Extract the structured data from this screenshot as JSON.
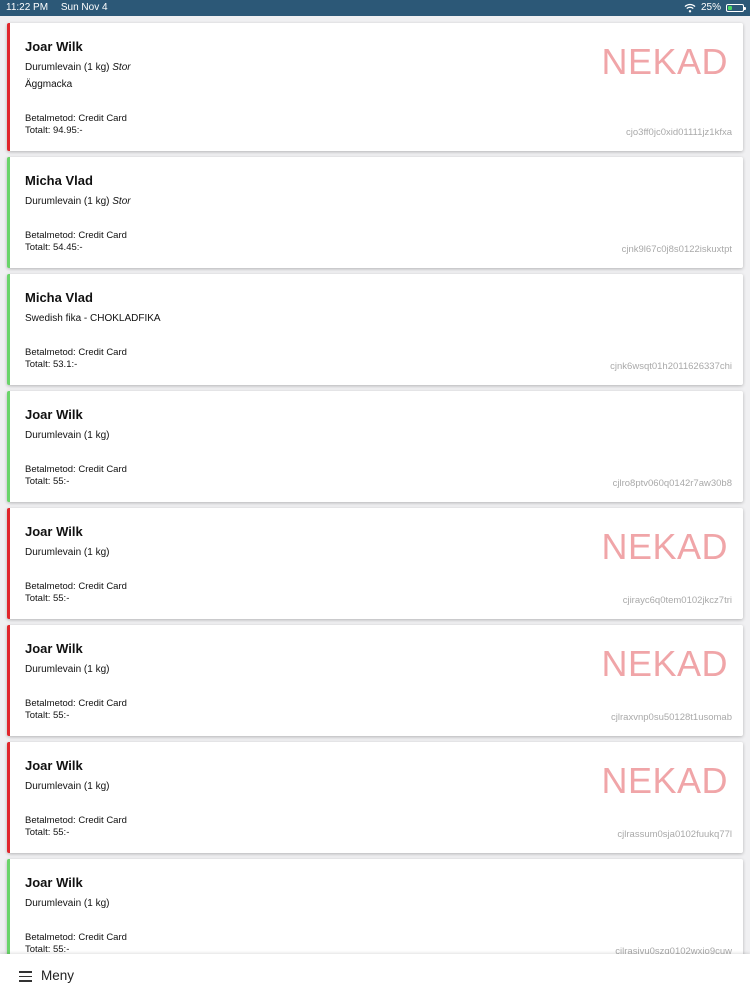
{
  "status_bar": {
    "time": "11:22 PM",
    "date": "Sun Nov 4",
    "battery": "25%",
    "battery_level": 0.25,
    "icons": [
      "wifi-icon",
      "battery-icon"
    ]
  },
  "colors": {
    "status_bar": "#2c5877",
    "accepted_accent": "#6ad46a",
    "rejected_accent": "#e0262c",
    "rejected_stamp": "#f0a5a8"
  },
  "orders": [
    {
      "customer": "Joar Wilk",
      "items": [
        {
          "name": "Durumlevain (1 kg)",
          "size": "Stor"
        },
        {
          "name": "Äggmacka",
          "size": ""
        }
      ],
      "payment": "Betalmetod: Credit Card",
      "total": "Totalt: 94.95:-",
      "order_id": "cjo3ff0jc0xid01111jz1kfxa",
      "status": "NEKAD",
      "rejected": true
    },
    {
      "customer": "Micha Vlad",
      "items": [
        {
          "name": "Durumlevain (1 kg)",
          "size": "Stor"
        }
      ],
      "payment": "Betalmetod: Credit Card",
      "total": "Totalt: 54.45:-",
      "order_id": "cjnk9l67c0j8s0122iskuxtpt",
      "status": "",
      "rejected": false
    },
    {
      "customer": "Micha Vlad",
      "items": [
        {
          "name": "Swedish fika - CHOKLADFIKA",
          "size": ""
        }
      ],
      "payment": "Betalmetod: Credit Card",
      "total": "Totalt: 53.1:-",
      "order_id": "cjnk6wsqt01h2011626337chi",
      "status": "",
      "rejected": false
    },
    {
      "customer": "Joar Wilk",
      "items": [
        {
          "name": "Durumlevain (1 kg)",
          "size": ""
        }
      ],
      "payment": "Betalmetod: Credit Card",
      "total": "Totalt: 55:-",
      "order_id": "cjlro8ptv060q0142r7aw30b8",
      "status": "",
      "rejected": false
    },
    {
      "customer": "Joar Wilk",
      "items": [
        {
          "name": "Durumlevain (1 kg)",
          "size": ""
        }
      ],
      "payment": "Betalmetod: Credit Card",
      "total": "Totalt: 55:-",
      "order_id": "cjirayc6q0tem0102jkcz7tri",
      "status": "NEKAD",
      "rejected": true
    },
    {
      "customer": "Joar Wilk",
      "items": [
        {
          "name": "Durumlevain (1 kg)",
          "size": ""
        }
      ],
      "payment": "Betalmetod: Credit Card",
      "total": "Totalt: 55:-",
      "order_id": "cjlraxvnp0su50128t1usomab",
      "status": "NEKAD",
      "rejected": true
    },
    {
      "customer": "Joar Wilk",
      "items": [
        {
          "name": "Durumlevain (1 kg)",
          "size": ""
        }
      ],
      "payment": "Betalmetod: Credit Card",
      "total": "Totalt: 55:-",
      "order_id": "cjlrassum0sja0102fuukq77l",
      "status": "NEKAD",
      "rejected": true
    },
    {
      "customer": "Joar Wilk",
      "items": [
        {
          "name": "Durumlevain (1 kg)",
          "size": ""
        }
      ],
      "payment": "Betalmetod: Credit Card",
      "total": "Totalt: 55:-",
      "order_id": "cjlrasivu0szq0102wxio9cuw",
      "status": "",
      "rejected": false
    }
  ],
  "bottom_bar": {
    "menu_label": "Meny",
    "menu_icon": "hamburger-icon"
  }
}
